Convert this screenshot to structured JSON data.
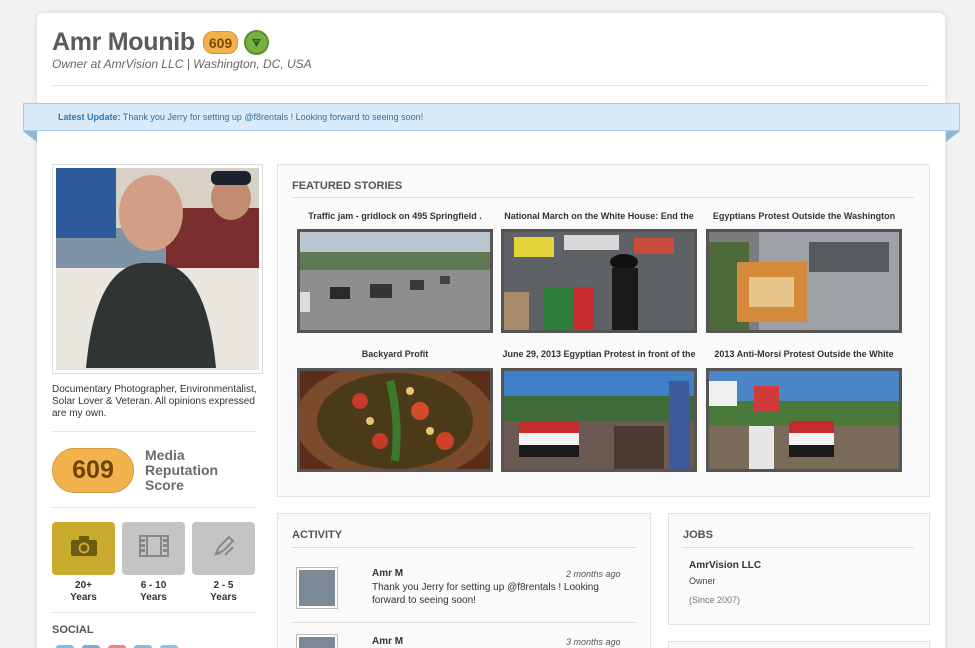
{
  "profile": {
    "name": "Amr Mounib",
    "score_badge": "609",
    "subtitle": "Owner at AmrVision LLC | Washington, DC, USA",
    "bio": "Documentary Photographer, Environmentalist, Solar Lover & Veteran. All opinions expressed are my own."
  },
  "update": {
    "label": "Latest Update:",
    "text": "Thank you Jerry for setting up @f8rentals ! Looking forward to seeing soon!"
  },
  "reputation": {
    "score": "609",
    "label": "Media Reputation Score"
  },
  "experience": [
    {
      "value": "20+",
      "unit": "Years",
      "icon": "camera-icon",
      "color": "#c9ac2d"
    },
    {
      "value": "6 - 10",
      "unit": "Years",
      "icon": "film-icon",
      "color": "#c4c4c4"
    },
    {
      "value": "2 - 5",
      "unit": "Years",
      "icon": "pen-icon",
      "color": "#c4c4c4"
    }
  ],
  "social": {
    "title": "SOCIAL"
  },
  "featured": {
    "title": "FEATURED STORIES",
    "stories": [
      {
        "title": "Traffic jam - gridlock on 495 Springfield ."
      },
      {
        "title": "National March on the White House: End the"
      },
      {
        "title": "Egyptians Protest Outside the Washington"
      },
      {
        "title": "Backyard Profit"
      },
      {
        "title": "June 29, 2013 Egyptian Protest in front of the"
      },
      {
        "title": "2013 Anti-Morsi Protest Outside the White"
      }
    ]
  },
  "activity": {
    "title": "ACTIVITY",
    "items": [
      {
        "name": "Amr M",
        "time": "2 months ago",
        "text": "Thank you Jerry for setting up @f8rentals ! Looking forward to seeing soon!"
      },
      {
        "name": "Amr M",
        "time": "3 months ago",
        "text": ""
      }
    ]
  },
  "jobs": {
    "title": "JOBS",
    "items": [
      {
        "company": "AmrVision LLC",
        "role": "Owner",
        "since": "(Since 2007)"
      }
    ]
  }
}
